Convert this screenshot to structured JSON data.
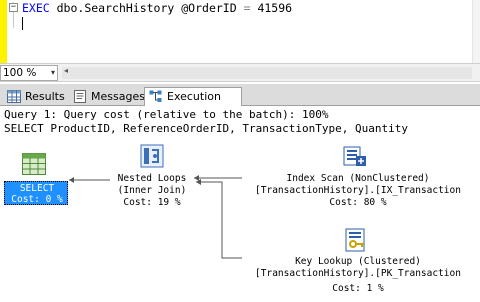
{
  "editor": {
    "collapse_glyph": "−",
    "code": {
      "kw_exec": "EXEC",
      "proc": " dbo.SearchHistory @OrderID ",
      "op": "=",
      "value": " 41596"
    }
  },
  "zoom": {
    "value": "100 %",
    "arrow": "▾",
    "scroll_left": "◂"
  },
  "tabs": [
    {
      "label": "Results",
      "icon": "grid-icon"
    },
    {
      "label": "Messages",
      "icon": "messages-icon"
    },
    {
      "label": "Execution plan",
      "icon": "execution-plan-icon",
      "active": true
    }
  ],
  "plan": {
    "header": "Query 1: Query cost (relative to the batch): 100%",
    "sql": "SELECT ProductID, ReferenceOrderID, TransactionType, Quantity",
    "nodes": {
      "select": {
        "line1": "SELECT",
        "line2": "Cost: 0 %",
        "icon": "select-icon"
      },
      "nested_loops": {
        "line1": "Nested Loops",
        "line2": "(Inner Join)",
        "line3": "Cost: 19 %",
        "icon": "nested-loops-icon"
      },
      "index_scan": {
        "line1": "Index Scan (NonClustered)",
        "line2": "[TransactionHistory].[IX_Transaction",
        "line3": "Cost: 80 %",
        "icon": "index-scan-icon"
      },
      "key_lookup": {
        "line1": "Key Lookup (Clustered)",
        "line2": "[TransactionHistory].[PK_Transaction",
        "line3": "Cost: 1 %",
        "icon": "key-lookup-icon"
      }
    }
  },
  "colors": {
    "selected": "#1e90ff",
    "gutter": "#fff200",
    "keyword": "#0000ff"
  }
}
